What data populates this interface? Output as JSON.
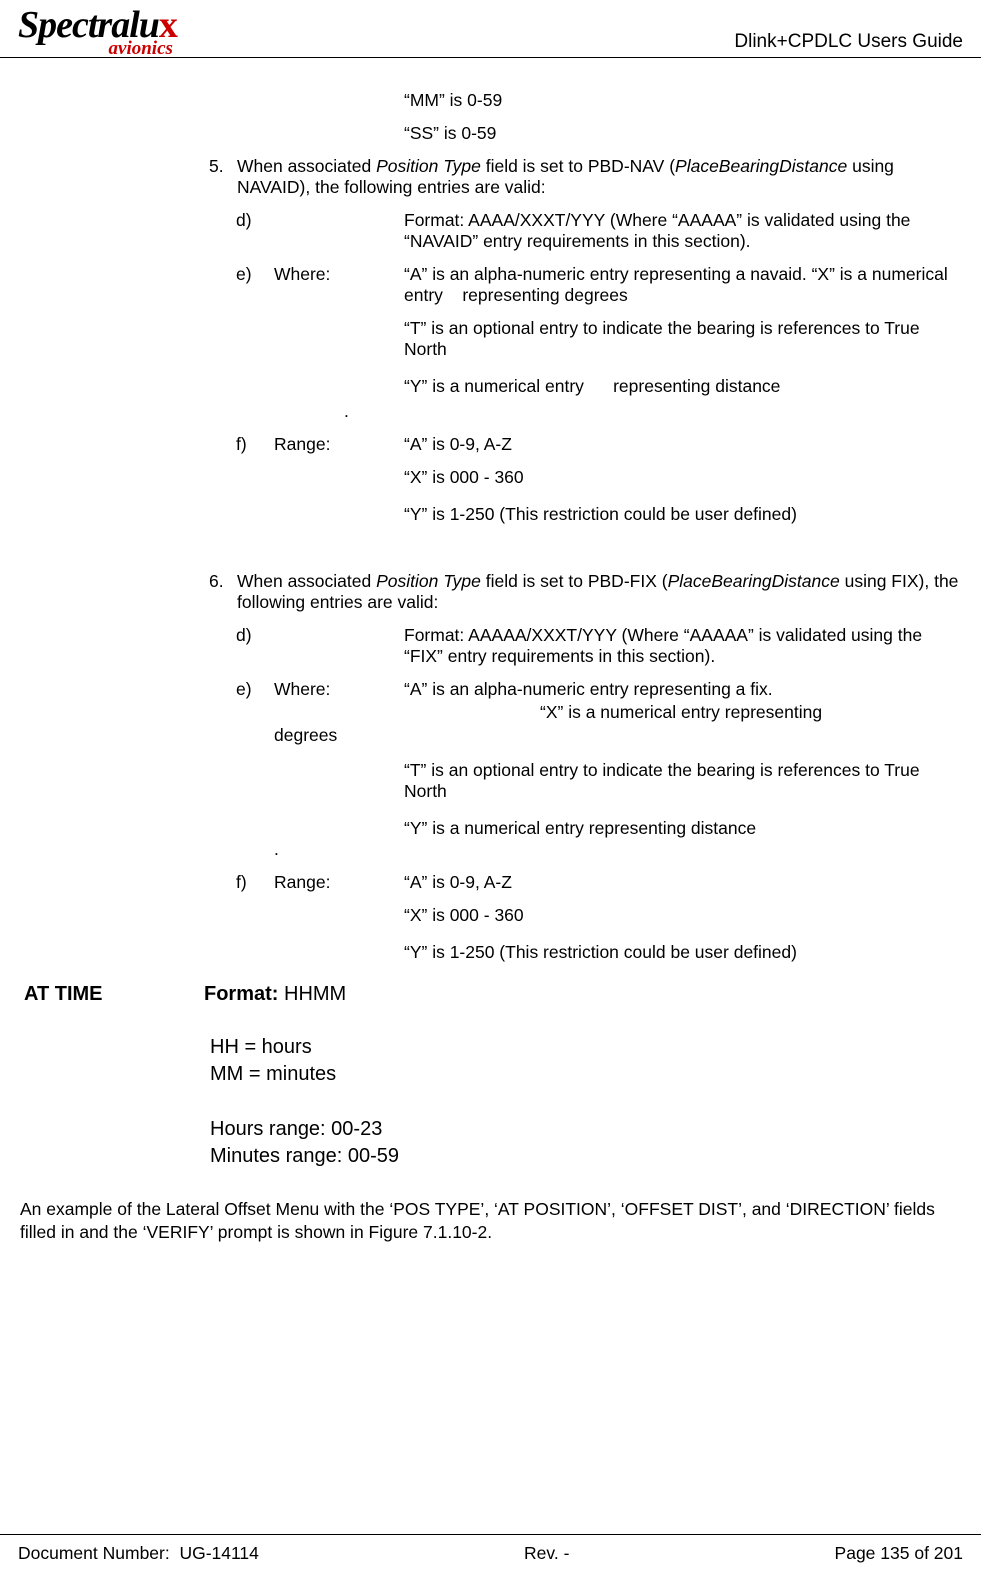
{
  "header": {
    "logo_main_pre": "Spectralu",
    "logo_main_x": "x",
    "logo_sub": "avionics",
    "title": "Dlink+CPDLC Users Guide"
  },
  "mm_line": "“MM” is 0-59",
  "ss_line": "“SS” is 0-59",
  "item5": {
    "num": "5.",
    "pre": "When associated ",
    "it1": "Position Type",
    "mid": " field is set to PBD-NAV (",
    "it2": "PlaceBearingDistance",
    "post": " using NAVAID), the following entries are valid:"
  },
  "i5d": {
    "letter": "d)",
    "body": "Format: AAAA/XXXT/YYY (Where “AAAAA” is validated using the “NAVAID” entry requirements in this section)."
  },
  "i5e": {
    "letter": "e)",
    "label": "Where:",
    "l1": "“A” is an alpha-numeric entry representing a navaid. “X” is a numerical entry    representing degrees",
    "l2": "“T” is an optional entry to indicate the bearing is references to True North",
    "l3": "“Y” is a numerical entry      representing distance"
  },
  "dot": ".",
  "i5f": {
    "letter": "f)",
    "label": "Range:",
    "l1": "“A” is 0-9, A-Z",
    "l2": "“X” is 000 - 360",
    "l3": "“Y” is 1-250 (This restriction could be user defined)"
  },
  "item6": {
    "num": "6.",
    "pre": "When associated ",
    "it1": "Position Type",
    "mid": " field is set to PBD-FIX (",
    "it2": "PlaceBearingDistance",
    "post": " using FIX), the following entries are valid:"
  },
  "i6d": {
    "letter": "d)",
    "body": "Format: AAAAA/XXXT/YYY (Where “AAAAA” is validated using the “FIX” entry requirements in this section)."
  },
  "i6e": {
    "letter": "e)",
    "label": "Where:",
    "l1a": "“A” is an alpha-numeric entry representing a fix.",
    "l1b": "“X” is a numerical entry representing",
    "degrees": "degrees",
    "l2": "“T” is an optional entry to indicate the bearing is references to True North",
    "l3": "“Y” is a numerical entry representing distance"
  },
  "i6f": {
    "letter": "f)",
    "label": "Range:",
    "l1": "“A” is 0-9, A-Z",
    "l2": "“X” is 000 - 360",
    "l3": "“Y” is 1-250 (This restriction could be user defined)"
  },
  "attime": {
    "label": "AT TIME",
    "format_b": "Format:",
    "format_v": " HHMM",
    "hh": "HH = hours",
    "mm": "MM = minutes",
    "hr": "Hours range: 00-23",
    "mr": "Minutes range: 00-59"
  },
  "example": "An example of the Lateral Offset Menu with the ‘POS TYPE’, ‘AT POSITION’, ‘OFFSET DIST’, and ‘DIRECTION’ fields filled in and the ‘VERIFY’ prompt is shown in Figure 7.1.10-2.",
  "footer": {
    "left": "Document Number:  UG-14114",
    "mid": "Rev. -",
    "right": "Page 135 of 201"
  }
}
